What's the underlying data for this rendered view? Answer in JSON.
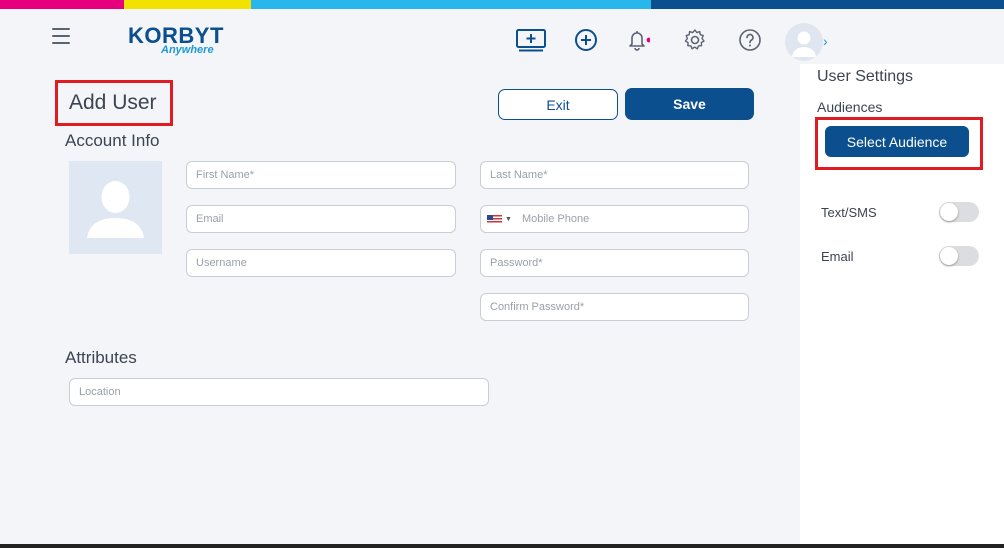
{
  "brand": {
    "name": "KORBYT",
    "subtitle": "Anywhere"
  },
  "colors": {
    "primary": "#0b4f8f",
    "highlight": "#e11b22",
    "stripe_magenta": "#e6007e",
    "stripe_yellow": "#f2e200",
    "stripe_cyan": "#29b6ec",
    "stripe_navy": "#0b4f8f"
  },
  "nav": {
    "icons": [
      "menu-icon",
      "screen-add-icon",
      "plus-circle-icon",
      "bell-icon",
      "gear-icon",
      "help-icon",
      "user-avatar-icon",
      "chevron-right-icon"
    ],
    "chevron": "›"
  },
  "page": {
    "title": "Add User"
  },
  "actions": {
    "exit_label": "Exit",
    "save_label": "Save"
  },
  "account_info": {
    "heading": "Account Info",
    "first_name_placeholder": "First Name*",
    "last_name_placeholder": "Last Name*",
    "email_placeholder": "Email",
    "mobile_placeholder": "Mobile Phone",
    "username_placeholder": "Username",
    "password_placeholder": "Password*",
    "confirm_password_placeholder": "Confirm Password*"
  },
  "attributes": {
    "heading": "Attributes",
    "location_placeholder": "Location"
  },
  "user_settings": {
    "title": "User Settings",
    "audiences_label": "Audiences",
    "select_audience_label": "Select Audience",
    "notifications": [
      {
        "label": "Text/SMS",
        "enabled": false
      },
      {
        "label": "Email",
        "enabled": false
      }
    ]
  }
}
